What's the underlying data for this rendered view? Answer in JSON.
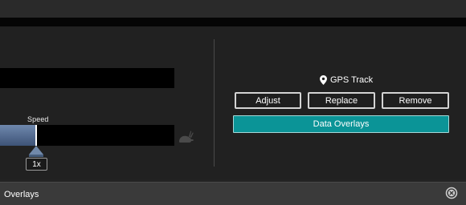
{
  "speed": {
    "label": "Speed",
    "value": "1x"
  },
  "gps": {
    "title": "GPS Track",
    "icon": "location-pin-icon"
  },
  "buttons": {
    "adjust": "Adjust",
    "replace": "Replace",
    "remove": "Remove",
    "data_overlays": "Data Overlays"
  },
  "panel": {
    "title": "Overlays",
    "close_icon": "close-circle-icon"
  },
  "colors": {
    "accent": "#0b9497",
    "slider_fill": "#6f88ad",
    "background": "#232323"
  }
}
